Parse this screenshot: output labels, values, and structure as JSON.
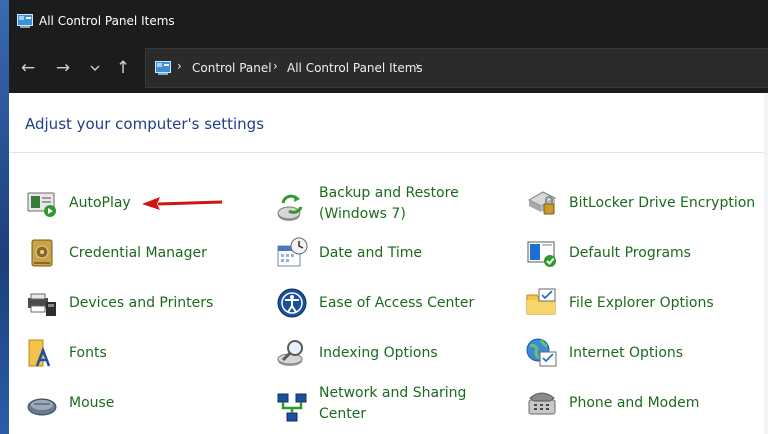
{
  "window": {
    "title": "All Control Panel Items"
  },
  "address": {
    "crumbs": [
      "Control Panel",
      "All Control Panel Items"
    ]
  },
  "content": {
    "heading": "Adjust your computer's settings",
    "items": [
      {
        "label": "AutoPlay",
        "icon": "autoplay-icon"
      },
      {
        "label": "Backup and Restore",
        "label2": "(Windows 7)",
        "icon": "backup-restore-icon"
      },
      {
        "label": "BitLocker Drive Encryption",
        "icon": "bitlocker-icon"
      },
      {
        "label": "Credential Manager",
        "icon": "credential-manager-icon"
      },
      {
        "label": "Date and Time",
        "icon": "date-time-icon"
      },
      {
        "label": "Default Programs",
        "icon": "default-programs-icon"
      },
      {
        "label": "Devices and Printers",
        "icon": "devices-printers-icon"
      },
      {
        "label": "Ease of Access Center",
        "icon": "ease-of-access-icon"
      },
      {
        "label": "File Explorer Options",
        "icon": "file-explorer-options-icon"
      },
      {
        "label": "Fonts",
        "icon": "fonts-icon"
      },
      {
        "label": "Indexing Options",
        "icon": "indexing-options-icon"
      },
      {
        "label": "Internet Options",
        "icon": "internet-options-icon"
      },
      {
        "label": "Mouse",
        "icon": "mouse-icon"
      },
      {
        "label": "Network and Sharing",
        "label2": "Center",
        "icon": "network-sharing-icon"
      },
      {
        "label": "Phone and Modem",
        "icon": "phone-modem-icon"
      }
    ]
  },
  "colors": {
    "link": "#1c6a1c",
    "heading": "#1e3f8a",
    "annotation_arrow": "#d21414"
  }
}
